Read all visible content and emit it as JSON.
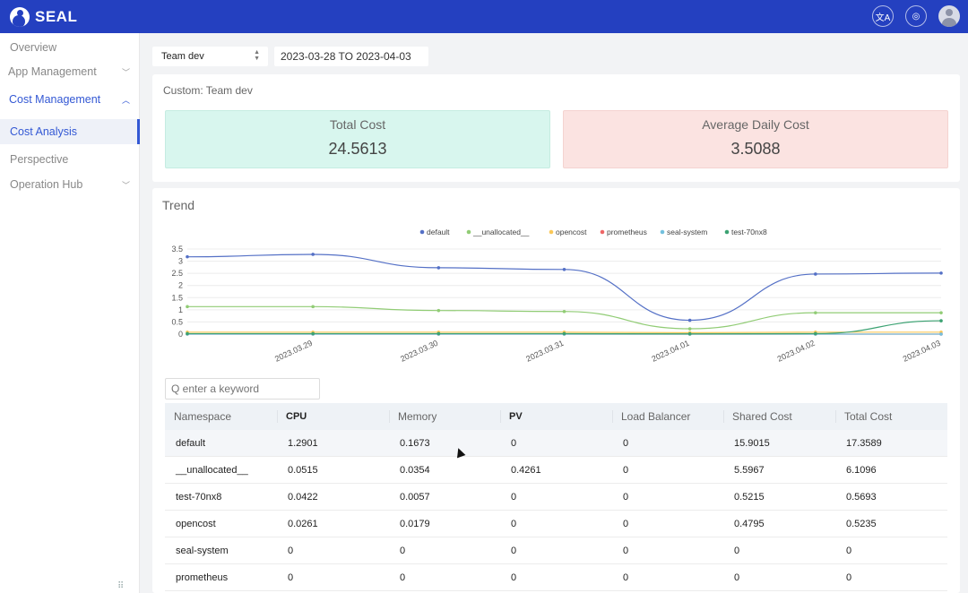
{
  "header": {
    "brand": "SEAL",
    "icons": [
      "translate-icon",
      "settings-icon",
      "user-avatar"
    ]
  },
  "sidebar": {
    "items": [
      {
        "label": "Overview",
        "state": "normal"
      },
      {
        "label": "App Management",
        "state": "collapsed-group"
      },
      {
        "label": "Cost Management",
        "state": "expanded-group"
      },
      {
        "label": "Cost Analysis",
        "state": "active"
      },
      {
        "label": "Perspective",
        "state": "normal"
      },
      {
        "label": "Operation Hub",
        "state": "collapsed-group"
      }
    ]
  },
  "filters": {
    "team_select": "Team dev",
    "date_range": "2023-03-28 TO 2023-04-03"
  },
  "summary": {
    "title": "Custom: Team dev",
    "total_cost_label": "Total Cost",
    "total_cost_value": "24.5613",
    "avg_daily_label": "Average Daily Cost",
    "avg_daily_value": "3.5088",
    "total_color": "#d8f6ee",
    "avg_color": "#fbe3e1"
  },
  "trend": {
    "title": "Trend",
    "search_placeholder": "Q enter a keyword"
  },
  "chart_data": {
    "type": "line",
    "x": [
      "2023.03.29",
      "2023.03.30",
      "2023.03.31",
      "2023.04.01",
      "2023.04.02",
      "2023.04.03"
    ],
    "ylim": [
      0,
      3.5
    ],
    "yticks": [
      "0",
      "0.5",
      "1",
      "1.5",
      "2",
      "2.5",
      "3",
      "3.5"
    ],
    "legend_position": "top-center",
    "grid": true,
    "series": [
      {
        "name": "default",
        "color": "#5470c6",
        "values": [
          3.18,
          3.28,
          2.73,
          2.66,
          0.57,
          2.47,
          2.51
        ]
      },
      {
        "name": "__unallocated__",
        "color": "#91cc75",
        "values": [
          1.13,
          1.13,
          0.97,
          0.93,
          0.22,
          0.88,
          0.88
        ]
      },
      {
        "name": "opencost",
        "color": "#fac858",
        "values": [
          0.08,
          0.08,
          0.08,
          0.08,
          0.06,
          0.08,
          0.08
        ]
      },
      {
        "name": "prometheus",
        "color": "#ee6666",
        "values": [
          0,
          0,
          0,
          0,
          0,
          0,
          0
        ]
      },
      {
        "name": "seal-system",
        "color": "#73c0de",
        "values": [
          0,
          0,
          0,
          0,
          0,
          0,
          0
        ]
      },
      {
        "name": "test-70nx8",
        "color": "#3ba272",
        "values": [
          0.02,
          0.02,
          0.02,
          0.02,
          0.01,
          0.02,
          0.55
        ]
      }
    ]
  },
  "table": {
    "columns": [
      "Namespace",
      "CPU",
      "Memory",
      "PV",
      "Load Balancer",
      "Shared Cost",
      "Total Cost"
    ],
    "rows": [
      [
        "default",
        "1.2901",
        "0.1673",
        "0",
        "0",
        "15.9015",
        "17.3589"
      ],
      [
        "__unallocated__",
        "0.0515",
        "0.0354",
        "0.4261",
        "0",
        "5.5967",
        "6.1096"
      ],
      [
        "test-70nx8",
        "0.0422",
        "0.0057",
        "0",
        "0",
        "0.5215",
        "0.5693"
      ],
      [
        "opencost",
        "0.0261",
        "0.0179",
        "0",
        "0",
        "0.4795",
        "0.5235"
      ],
      [
        "seal-system",
        "0",
        "0",
        "0",
        "0",
        "0",
        "0"
      ],
      [
        "prometheus",
        "0",
        "0",
        "0",
        "0",
        "0",
        "0"
      ]
    ]
  }
}
